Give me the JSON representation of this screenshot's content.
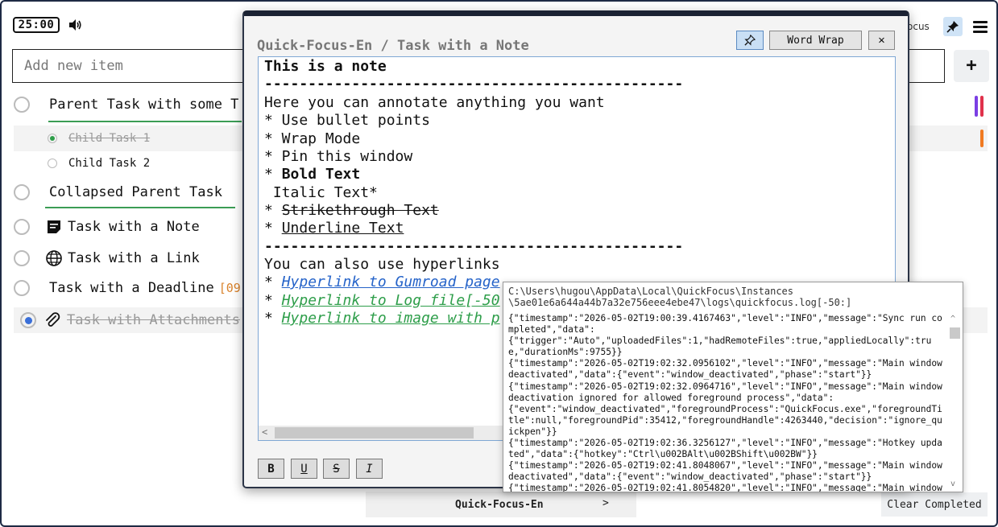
{
  "topbar": {
    "timer": "25:00",
    "right_label": "ocus",
    "add_placeholder": "Add new item",
    "add_button": "+"
  },
  "tasks": {
    "parent1": "Parent Task with some T",
    "child1": "Child Task 1",
    "child2": "Child Task 2",
    "collapsed": "Collapsed Parent Task",
    "note_task": "Task with a Note",
    "link_task": "Task with a Link",
    "deadline_task": "Task with a Deadline",
    "deadline_value": "[09",
    "attach_task": "Task with Attachments"
  },
  "colors": {
    "accent_purple": "#7b3fe4",
    "accent_red": "#e0314b",
    "accent_orange": "#f07a22",
    "green_underline": "#3b9d55"
  },
  "note": {
    "title": "Quick-Focus-En / Task with a Note",
    "word_wrap": "Word Wrap",
    "close": "✕",
    "lines": {
      "l1": "This is a note",
      "l2": "------------------------------------------------",
      "l3": "Here you can annotate anything you want",
      "l4": "* Use bullet points",
      "l5": "* Wrap Mode",
      "l6": "* Pin this window",
      "l7_prefix": "* ",
      "l7_bold": "Bold Text",
      "l8": " Italic Text*",
      "l9_prefix": "* ",
      "l9_strike": "Strikethrough Text",
      "l10_prefix": "* ",
      "l10_under": "Underline Text",
      "l11": "------------------------------------------------",
      "l12": "You can also use hyperlinks",
      "l13_prefix": "* ",
      "l13_link": "Hyperlink to Gumroad page",
      "l14_prefix": "* ",
      "l14_link": "Hyperlink to Log file[-50",
      "l15_prefix": "* ",
      "l15_link": "Hyperlink to image with p"
    },
    "format_buttons": {
      "bold": "B",
      "underline": "U",
      "strike": "S",
      "italic": "I"
    }
  },
  "log_popup": {
    "path_line1": "C:\\Users\\hugou\\AppData\\Local\\QuickFocus\\Instances",
    "path_line2": "\\5ae01e6a644a44b7a32e756eee4ebe47\\logs\\quickfocus.log[-50:]",
    "content": "{\"timestamp\":\"2026-05-02T19:00:39.4167463\",\"level\":\"INFO\",\"message\":\"Sync run completed\",\"data\":\n{\"trigger\":\"Auto\",\"uploadedFiles\":1,\"hadRemoteFiles\":true,\"appliedLocally\":true,\"durationMs\":9755}}\n{\"timestamp\":\"2026-05-02T19:02:32.0956102\",\"level\":\"INFO\",\"message\":\"Main window deactivated\",\"data\":{\"event\":\"window_deactivated\",\"phase\":\"start\"}}\n{\"timestamp\":\"2026-05-02T19:02:32.0964716\",\"level\":\"INFO\",\"message\":\"Main window deactivation ignored for allowed foreground process\",\"data\":\n{\"event\":\"window_deactivated\",\"foregroundProcess\":\"QuickFocus.exe\",\"foregroundTitle\":null,\"foregroundPid\":35412,\"foregroundHandle\":4263440,\"decision\":\"ignore_quickpen\"}}\n{\"timestamp\":\"2026-05-02T19:02:36.3256127\",\"level\":\"INFO\",\"message\":\"Hotkey updated\",\"data\":{\"hotkey\":\"Ctrl\\u002BAlt\\u002BShift\\u002BW\"}}\n{\"timestamp\":\"2026-05-02T19:02:41.8048067\",\"level\":\"INFO\",\"message\":\"Main window deactivated\",\"data\":{\"event\":\"window_deactivated\",\"phase\":\"start\"}}\n{\"timestamp\":\"2026-05-02T19:02:41.8054820\",\"level\":\"INFO\",\"message\":\"Main window"
  },
  "bottombar": {
    "project": "Quick-Focus-En",
    "next": ">",
    "clear_completed": "Clear Completed"
  }
}
